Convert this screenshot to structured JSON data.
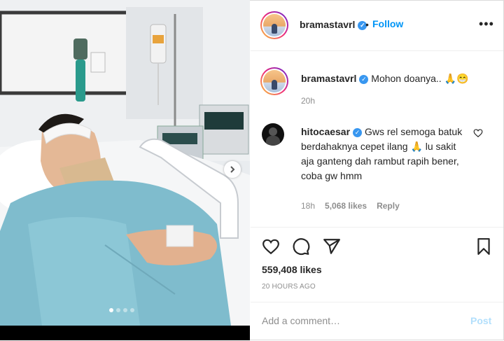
{
  "post": {
    "author": "bramastavrl",
    "verified_mark": "✓",
    "follow_label": "Follow",
    "separator": "•",
    "more_label": "•••"
  },
  "media": {
    "dot_count": 4,
    "active_dot": 1
  },
  "caption": {
    "username": "bramastavrl",
    "text": "Mohon doanya.. 🙏😁",
    "time": "20h"
  },
  "comment": {
    "username": "hitocaesar",
    "text": "Gws rel semoga batuk berdahaknya cepet ilang 🙏 lu sakit aja ganteng dah rambut rapih bener, coba gw hmm",
    "time": "18h",
    "likes": "5,068 likes",
    "reply_label": "Reply"
  },
  "engagement": {
    "likes": "559,408 likes",
    "posted_ago": "20 HOURS AGO"
  },
  "add_comment": {
    "placeholder": "Add a comment…",
    "post_label": "Post"
  },
  "icons": [
    "chevron-right-icon",
    "heart-icon",
    "comment-icon",
    "share-icon",
    "bookmark-icon",
    "more-icon",
    "verified-icon"
  ],
  "colors": {
    "link_blue": "#0095f6",
    "verified_blue": "#3897f0",
    "muted": "#8e8e8e",
    "post_disabled": "#b2dffc"
  }
}
